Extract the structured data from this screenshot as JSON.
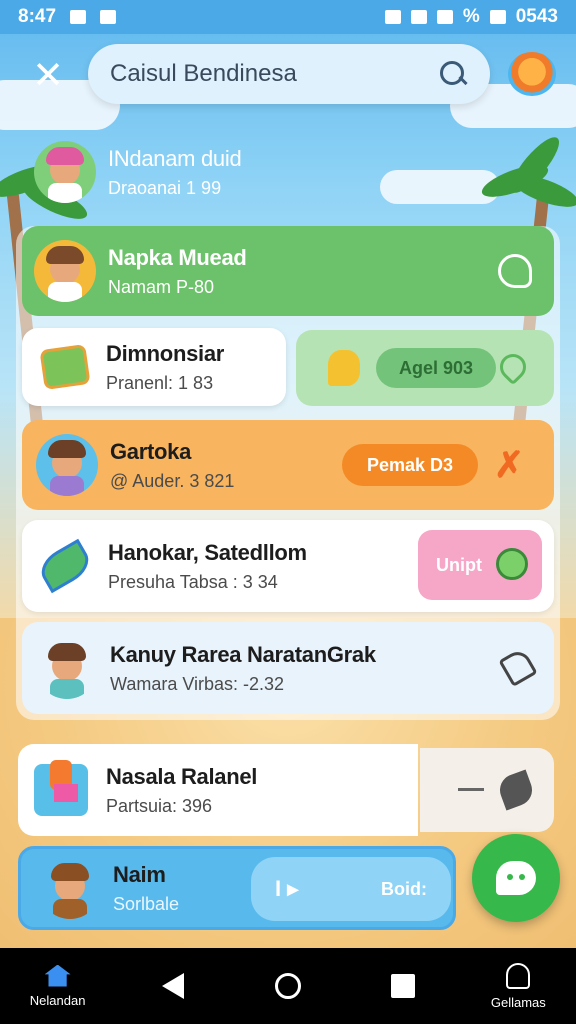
{
  "status_bar": {
    "time": "8:47",
    "right_text": "0543",
    "battery_label": "%"
  },
  "search": {
    "value": "Caisul Bendinesa"
  },
  "items": [
    {
      "title": "INdanam duid",
      "subtitle": "Draoanai 1 99"
    },
    {
      "title": "Napka Muead",
      "subtitle": "Namam P-80"
    },
    {
      "title": "Dimnonsiar",
      "subtitle": "Pranenl: 1 83"
    },
    {
      "title": "Gartoka",
      "subtitle": "@ Auder. 3 821"
    },
    {
      "title": "Hanokar, Satedllom",
      "subtitle": "Presuha Tabsa : 3 34"
    },
    {
      "title": "Kanuy Rarea NaratanGrak",
      "subtitle": "Wamara Virbas: -2.32"
    },
    {
      "title": "Nasala Ralanel",
      "subtitle": "Partsuia: 396"
    },
    {
      "title": "Naim",
      "subtitle": "Sorlbale"
    }
  ],
  "pills": {
    "agent": "Agel 903",
    "pemak": "Pemak D3",
    "unipt": "Unipt",
    "bold": "Boid:"
  },
  "nav": {
    "left_label": "Nelandan",
    "right_label": "Gellamas"
  },
  "colors": {
    "green_row": "#6cc26a",
    "orange_row": "#f8b45e",
    "pink_pill": "#f6a6c6",
    "accent": "#3a8ff0"
  }
}
